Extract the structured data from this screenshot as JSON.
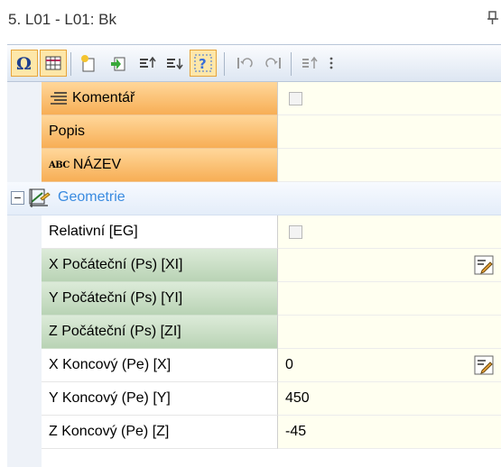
{
  "window": {
    "title": "5. L01 - L01: Bk"
  },
  "toolbar": {
    "buttons": [
      {
        "icon": "omega-icon",
        "active": true
      },
      {
        "icon": "ruler-grid-icon",
        "active": true
      },
      {
        "icon": "new-sparkle-icon",
        "active": false
      },
      {
        "icon": "green-arrow-import-icon",
        "active": false
      },
      {
        "icon": "sort-up-icon",
        "active": false
      },
      {
        "icon": "sort-down-icon",
        "active": false
      },
      {
        "icon": "help-question-icon",
        "active": true
      },
      {
        "icon": "rotate-left-icon",
        "active": false
      },
      {
        "icon": "rotate-right-icon",
        "active": false
      },
      {
        "icon": "move-up-icon",
        "active": false
      }
    ]
  },
  "rows": [
    {
      "label": "Komentář",
      "style": "orange",
      "icon": "comment-lines-icon",
      "value_type": "checkbox",
      "value": ""
    },
    {
      "label": "Popis",
      "style": "orange",
      "value_type": "text",
      "value": ""
    },
    {
      "label": "NÁZEV",
      "style": "orange",
      "icon_text": "ABC",
      "value_type": "text",
      "value": ""
    },
    {
      "group": true,
      "label": "Geometrie",
      "icon": "geometry-icon",
      "toggle": "−"
    },
    {
      "label": "Relativní [EG]",
      "style": "plain",
      "value_type": "checkbox",
      "value": ""
    },
    {
      "label": "X Počáteční (Ps) [XI]",
      "style": "green",
      "value_type": "text",
      "value": "",
      "edit_button": true
    },
    {
      "label": "Y Počáteční (Ps) [YI]",
      "style": "green",
      "value_type": "text",
      "value": ""
    },
    {
      "label": "Z Počáteční (Ps) [ZI]",
      "style": "green",
      "value_type": "text",
      "value": ""
    },
    {
      "label": "X Koncový (Pe) [X]",
      "style": "plain",
      "value_type": "text",
      "value": "0",
      "edit_button": true
    },
    {
      "label": "Y Koncový (Pe) [Y]",
      "style": "plain",
      "value_type": "text",
      "value": "450"
    },
    {
      "label": "Z Koncový (Pe) [Z]",
      "style": "plain",
      "value_type": "text",
      "value": "-45"
    }
  ],
  "colors": {
    "orange_label": "#f7ae55",
    "green_label": "#b9d3b5",
    "value_bg": "#fffff0",
    "group_text": "#3a8be0"
  }
}
